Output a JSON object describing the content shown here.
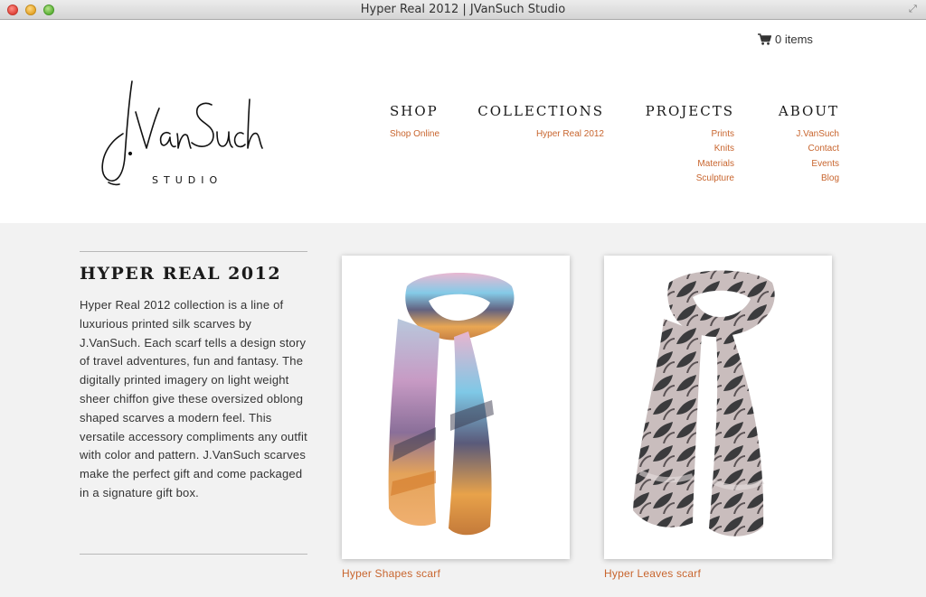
{
  "window": {
    "title": "Hyper Real 2012 | JVanSuch Studio"
  },
  "header": {
    "cart_label": "0 items",
    "logo": {
      "script_text": "J.VanSuch",
      "sub_text": "STUDIO"
    }
  },
  "nav": [
    {
      "label": "SHOP",
      "links": [
        "Shop Online"
      ]
    },
    {
      "label": "COLLECTIONS",
      "links": [
        "Hyper Real 2012"
      ]
    },
    {
      "label": "PROJECTS",
      "links": [
        "Prints",
        "Knits",
        "Materials",
        "Sculpture"
      ]
    },
    {
      "label": "ABOUT",
      "links": [
        "J.VanSuch",
        "Contact",
        "Events",
        "Blog"
      ]
    }
  ],
  "collection": {
    "title": "HYPER REAL 2012",
    "description": "Hyper Real 2012 collection is a line of luxurious printed silk scarves by J.VanSuch. Each scarf tells a design story of travel adventures, fun and fantasy. The digitally printed imagery on light weight sheer chiffon give these oversized oblong shaped scarves a modern feel. This versatile accessory compliments any outfit with color and pattern. J.VanSuch scarves make the perfect gift and come packaged in a signature gift box."
  },
  "products": [
    {
      "name": "Hyper Shapes scarf"
    },
    {
      "name": "Hyper Leaves scarf"
    }
  ],
  "colors": {
    "accent": "#c8652e",
    "background": "#f2f2f2",
    "header_bg": "#ffffff"
  }
}
